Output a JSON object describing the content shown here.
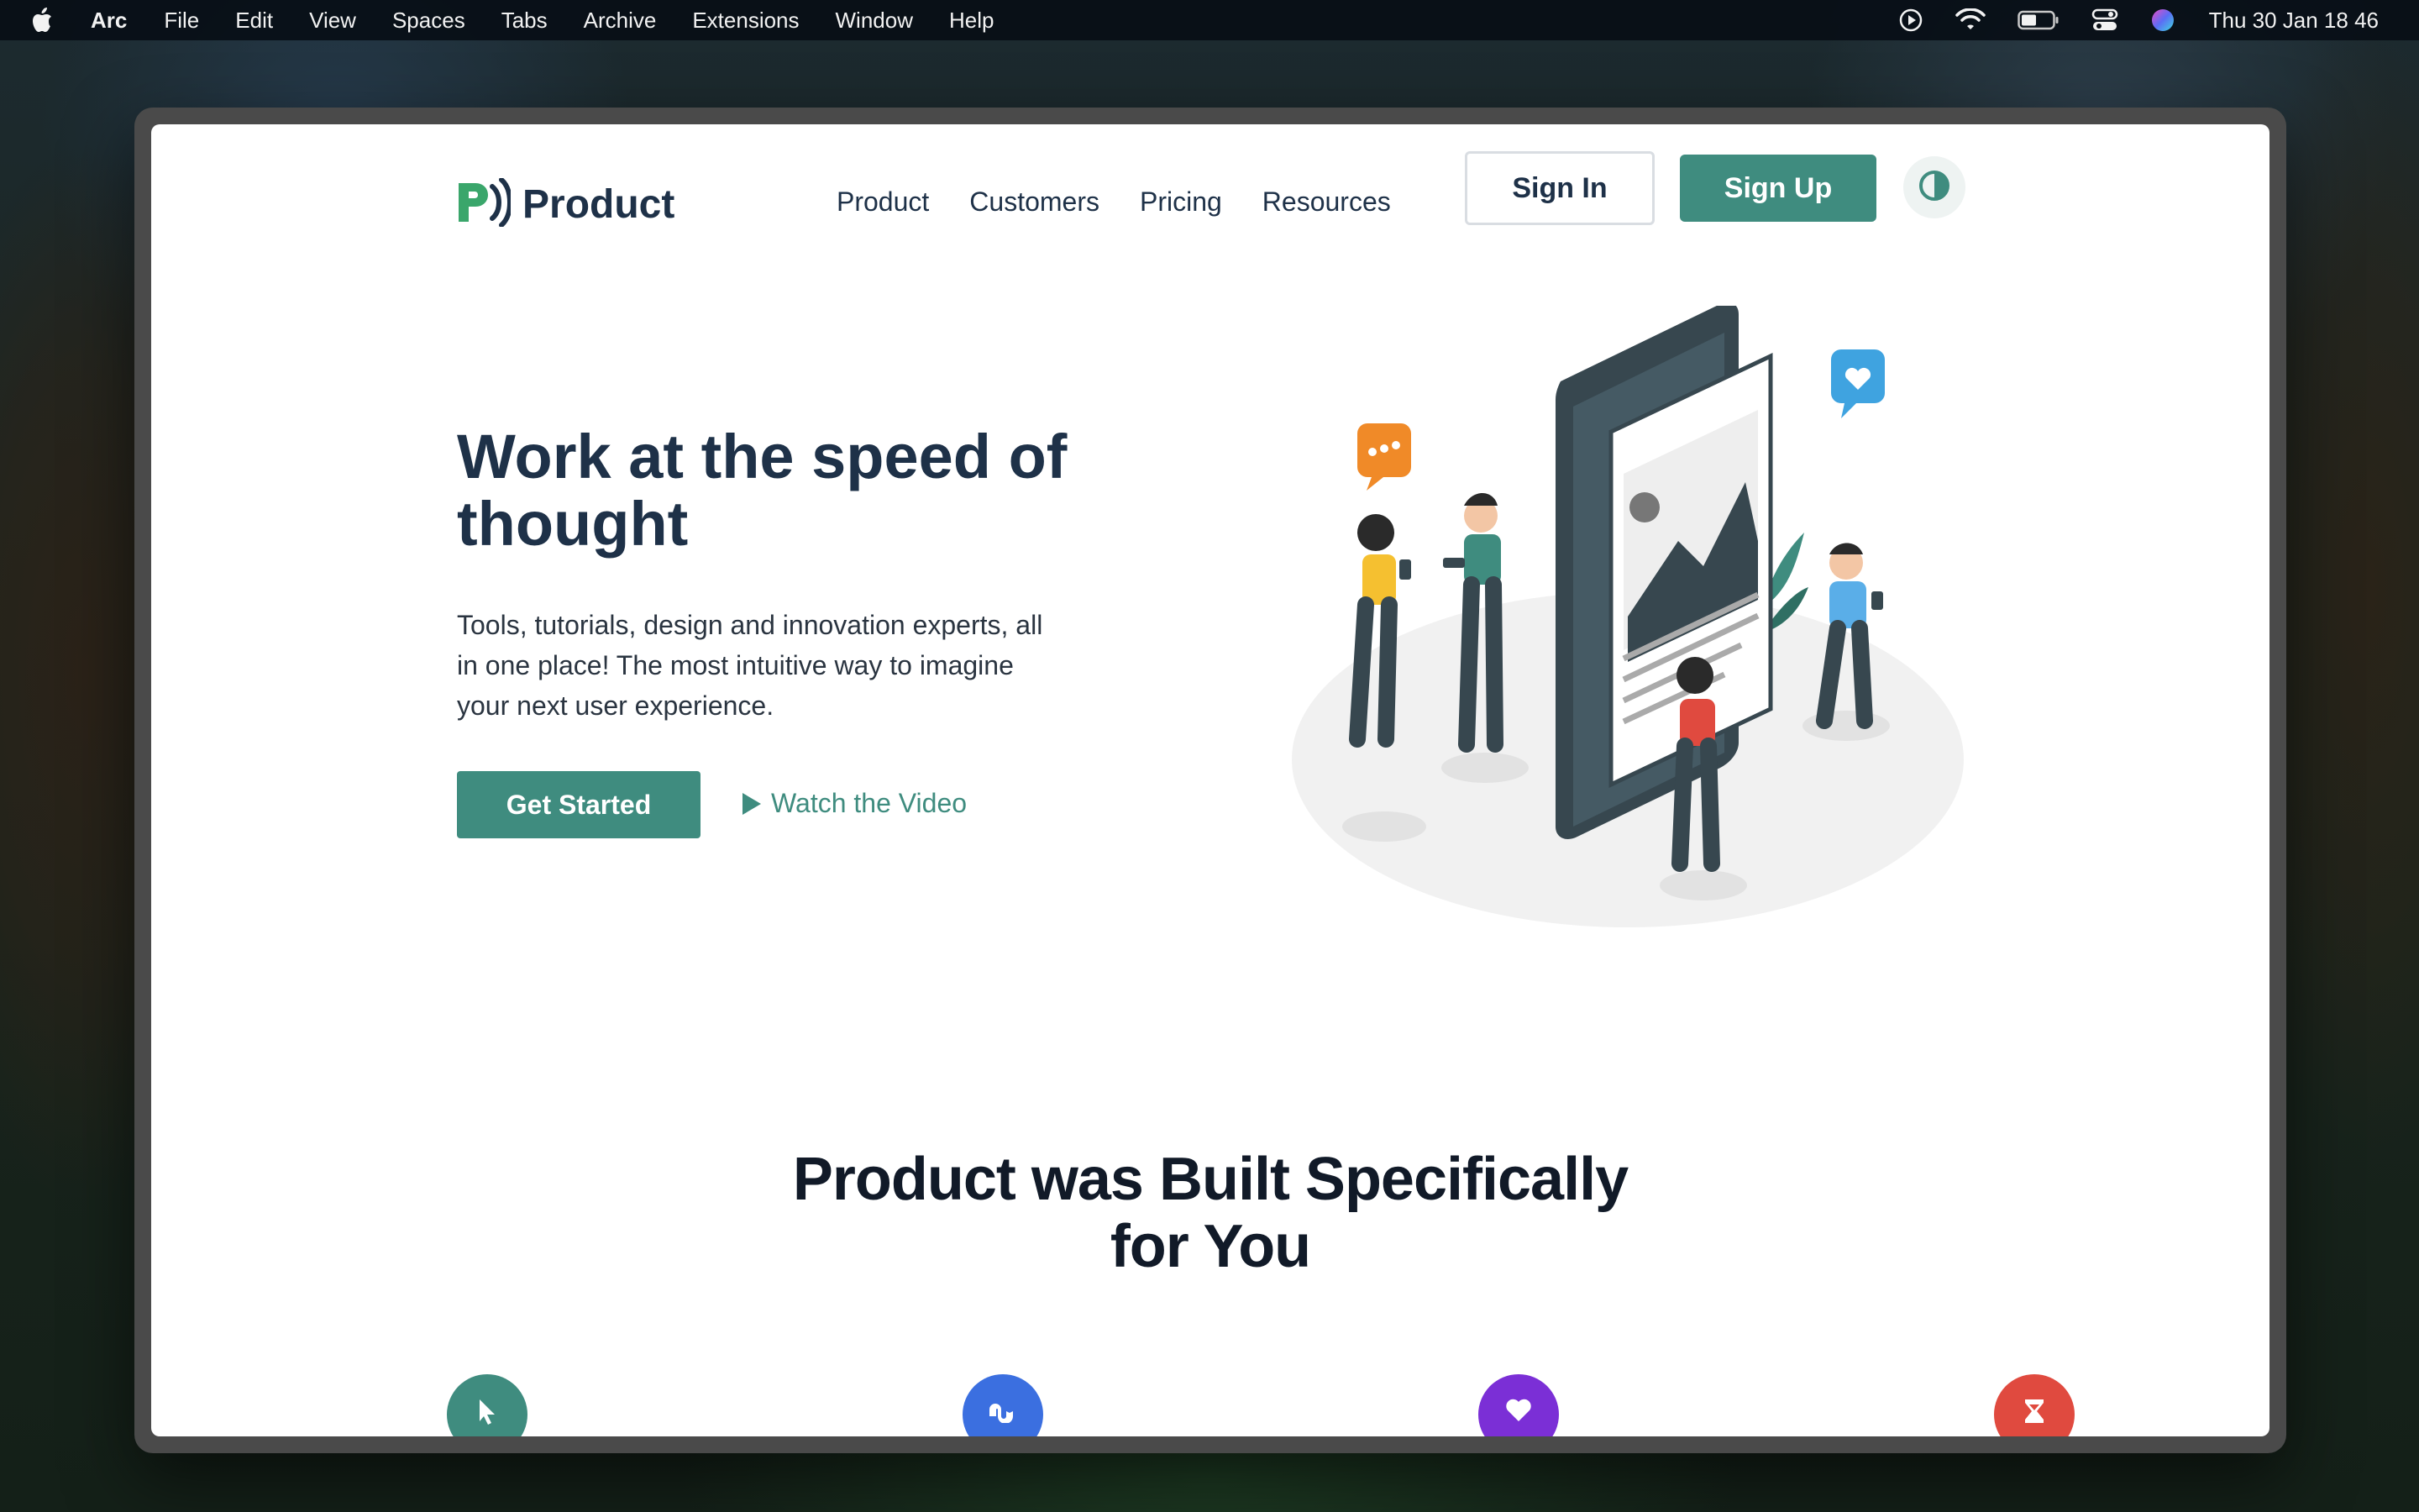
{
  "menubar": {
    "apple_icon": "apple-icon",
    "app_name": "Arc",
    "items": [
      "File",
      "Edit",
      "View",
      "Spaces",
      "Tabs",
      "Archive",
      "Extensions",
      "Window",
      "Help"
    ],
    "status_icons": [
      "play-circle-icon",
      "wifi-icon",
      "battery-icon",
      "control-center-icon",
      "siri-icon"
    ],
    "clock": "Thu 30 Jan  18 46"
  },
  "header": {
    "logo_text": "Product",
    "nav": [
      "Product",
      "Customers",
      "Pricing",
      "Resources"
    ],
    "sign_in": "Sign In",
    "sign_up": "Sign Up",
    "theme_toggle_icon": "contrast-icon"
  },
  "hero": {
    "title": "Work at the speed of thought",
    "description": "Tools, tutorials, design and innovation experts, all in one place! The most intuitive way to imagine your next user experience.",
    "cta_primary": "Get Started",
    "cta_secondary": "Watch the Video",
    "illustration": "people-with-phones-illustration"
  },
  "features": {
    "title": "Product was Built Specifically for You",
    "icons": [
      {
        "name": "cursor-icon",
        "color": "#3f8c7f"
      },
      {
        "name": "stumbleupon-icon",
        "color": "#3b6fe0"
      },
      {
        "name": "heart-icon",
        "color": "#7b2fd6"
      },
      {
        "name": "hourglass-icon",
        "color": "#e04a3f"
      }
    ]
  },
  "colors": {
    "accent": "#3f8c7f",
    "heading": "#1e3148"
  }
}
